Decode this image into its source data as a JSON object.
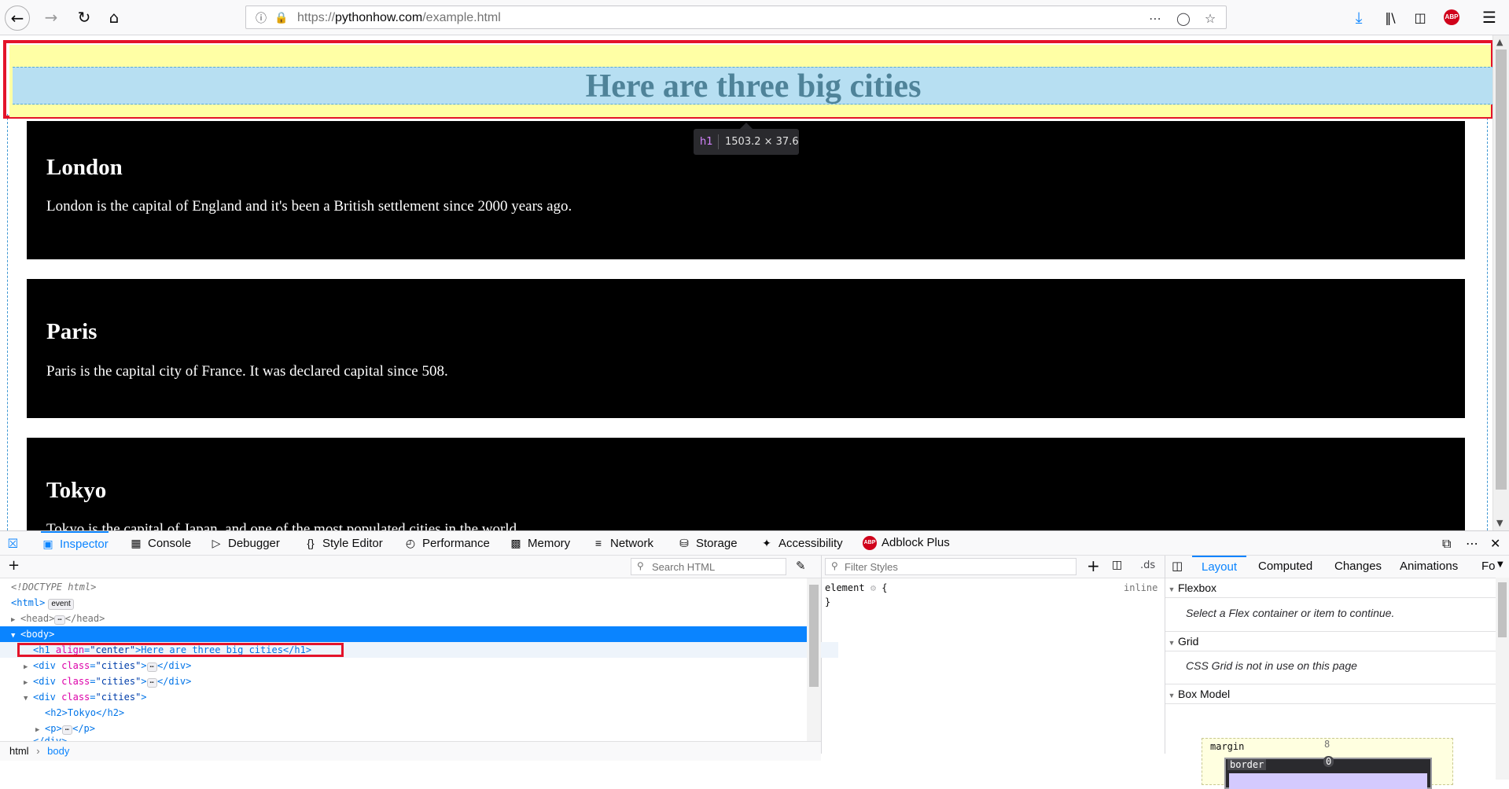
{
  "browser": {
    "url_host": "https://pythonhow.com",
    "url_path": "/example.html",
    "url_scheme": "https://",
    "url_domain": "pythonhow.com",
    "abp_label": "ABP"
  },
  "page": {
    "h1_text": "Here are three big cities",
    "cities": [
      {
        "name": "London",
        "desc": "London is the capital of England and it's been a British settlement since 2000 years ago."
      },
      {
        "name": "Paris",
        "desc": "Paris is the capital city of France. It was declared capital since 508."
      },
      {
        "name": "Tokyo",
        "desc": "Tokyo is the capital of Japan, and one of the most populated cities in the world."
      }
    ],
    "tooltip_tag": "h1",
    "tooltip_dims": "1503.2 × 37.6"
  },
  "devtools": {
    "tabs": [
      "Inspector",
      "Console",
      "Debugger",
      "Style Editor",
      "Performance",
      "Memory",
      "Network",
      "Storage",
      "Accessibility",
      "Adblock Plus"
    ],
    "active_tab": "Inspector",
    "search_html_placeholder": "Search HTML",
    "filter_styles_placeholder": "Filter Styles",
    "ds_label": ".ds",
    "tree": {
      "doctype": "<!DOCTYPE html>",
      "html_tag": "<html>",
      "event_badge": "event",
      "head_open": "<head>",
      "head_close": "</head>",
      "body_tag": "<body>",
      "h1_open": "<h1",
      "h1_attr": "align",
      "h1_attr_val": "\"center\"",
      "h1_inner": ">Here are three big cities</h1>",
      "div_open": "<div",
      "div_attr": "class",
      "div_attr_val": "\"cities\"",
      "div_close": "</div>",
      "h2_line": "<h2>Tokyo</h2>",
      "p_open": "<p>",
      "p_close": "</p>",
      "div_end": "</div>"
    },
    "breadcrumb": [
      "html",
      "body"
    ],
    "rules": {
      "selector": "element",
      "brace_open": "{",
      "brace_close": "}",
      "source": "inline"
    },
    "layout_tabs": [
      "Layout",
      "Computed",
      "Changes",
      "Animations",
      "Fo"
    ],
    "flexbox_title": "Flexbox",
    "flexbox_msg": "Select a Flex container or item to continue.",
    "grid_title": "Grid",
    "grid_msg": "CSS Grid is not in use on this page",
    "box_model_title": "Box Model",
    "bm_margin_label": "margin",
    "bm_margin_top": "8",
    "bm_border_label": "border",
    "bm_border_top": "0"
  }
}
